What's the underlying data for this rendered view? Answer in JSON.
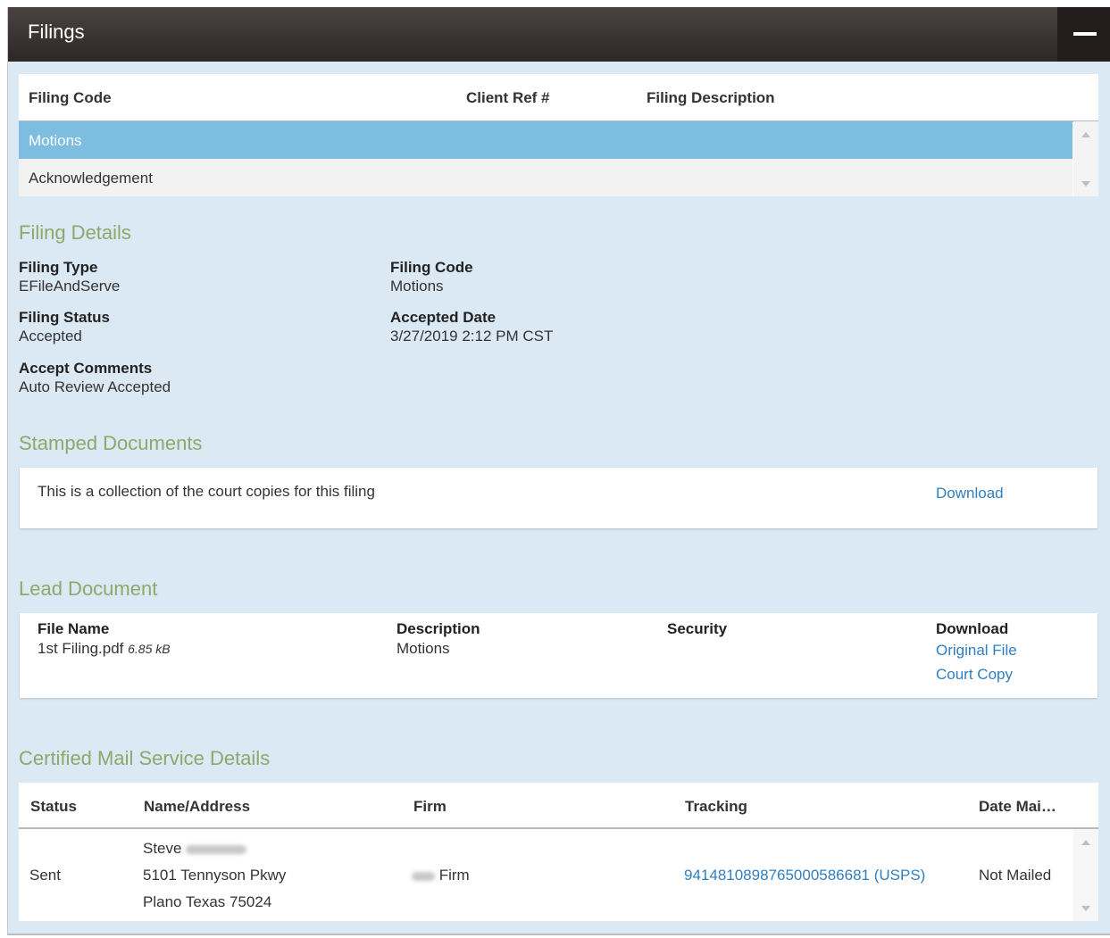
{
  "panel": {
    "title": "Filings"
  },
  "filings_grid": {
    "columns": [
      "Filing Code",
      "Client Ref #",
      "Filing Description"
    ],
    "rows": [
      "Motions",
      "Acknowledgement"
    ]
  },
  "filing_details": {
    "heading": "Filing Details",
    "filing_type_label": "Filing Type",
    "filing_type_value": "EFileAndServe",
    "filing_code_label": "Filing Code",
    "filing_code_value": "Motions",
    "filing_status_label": "Filing Status",
    "filing_status_value": "Accepted",
    "accepted_date_label": "Accepted Date",
    "accepted_date_value": "3/27/2019 2:12 PM CST",
    "accept_comments_label": "Accept Comments",
    "accept_comments_value": "Auto Review Accepted"
  },
  "stamped_documents": {
    "heading": "Stamped Documents",
    "description": "This is a collection of the court copies for this filing",
    "download_label": "Download"
  },
  "lead_document": {
    "heading": "Lead Document",
    "file_name_label": "File Name",
    "file_name": "1st Filing.pdf",
    "file_size": "6.85 kB",
    "description_label": "Description",
    "description_value": "Motions",
    "security_label": "Security",
    "download_label": "Download",
    "original_file_link": "Original File",
    "court_copy_link": "Court Copy"
  },
  "certified_mail": {
    "heading": "Certified Mail Service Details",
    "columns": [
      "Status",
      "Name/Address",
      "Firm",
      "Tracking",
      "Date Mai…"
    ],
    "row": {
      "status": "Sent",
      "name": "Steve",
      "address_line1": "5101 Tennyson Pkwy",
      "address_line2": "Plano Texas 75024",
      "firm": "Firm",
      "tracking": "9414810898765000586681 (USPS)",
      "date_mailed": "Not Mailed"
    }
  },
  "colors": {
    "header_bg": "#3a3232",
    "panel_bg": "#dbe9f4",
    "selected_row": "#7dbde0",
    "section_title": "#8aa96a",
    "link": "#2f7fc1"
  }
}
